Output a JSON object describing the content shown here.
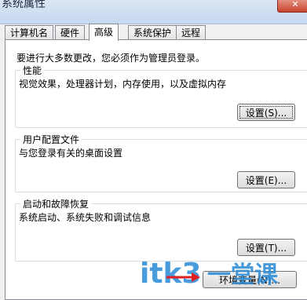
{
  "window": {
    "title": "系统属性",
    "close_label": "✕"
  },
  "tabs": [
    {
      "label": "计算机名",
      "active": false
    },
    {
      "label": "硬件",
      "active": false
    },
    {
      "label": "高级",
      "active": true
    },
    {
      "label": "系统保护",
      "active": false
    },
    {
      "label": "远程",
      "active": false
    }
  ],
  "intro_text": "要进行大多数更改，您必须作为管理员登录。",
  "groups": {
    "performance": {
      "title": "性能",
      "desc": "视觉效果，处理器计划，内存使用，以及虚拟内存",
      "button": "设置(S)..."
    },
    "user_profiles": {
      "title": "用户配置文件",
      "desc": "与您登录有关的桌面设置",
      "button": "设置(E)..."
    },
    "startup_recovery": {
      "title": "启动和故障恢复",
      "desc": "系统启动、系统失败和调试信息",
      "button": "设置(T)..."
    }
  },
  "env_button": "环境变量(N)...",
  "watermark": {
    "brand": "itk3",
    "tagline": "一堂课",
    "accent": "#2a8bd6"
  }
}
